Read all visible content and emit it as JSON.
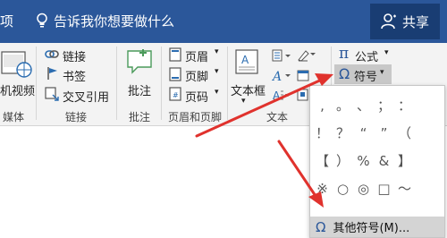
{
  "topbar": {
    "tab_partial": "项",
    "tellme": "告诉我你想要做什么",
    "share": "共享"
  },
  "ribbon": {
    "media": {
      "item": "机视频",
      "group": "媒体"
    },
    "links": {
      "link": "链接",
      "bookmark": "书签",
      "crossref": "交叉引用",
      "group": "链接"
    },
    "comments": {
      "comment": "批注",
      "group": "批注"
    },
    "header_footer": {
      "header": "页眉",
      "footer": "页脚",
      "page_number": "页码",
      "group": "页眉和页脚"
    },
    "text": {
      "textbox": "文本框",
      "group": "文本"
    },
    "symbols": {
      "equation": "公式",
      "symbol": "符号"
    }
  },
  "symbol_dropdown": {
    "symbols": [
      ",",
      "。",
      "、",
      "；",
      "：",
      "",
      "！",
      "？",
      "“",
      "”",
      "（",
      "",
      "【",
      "）",
      "%",
      "&",
      "】",
      "",
      "※",
      "○",
      "◎",
      "□",
      "～",
      ""
    ],
    "more_symbols": "其他符号(M)..."
  },
  "colors": {
    "title_bar": "#2b579a",
    "arrow": "#e0322d"
  }
}
